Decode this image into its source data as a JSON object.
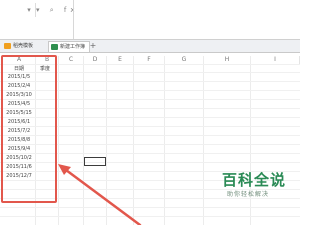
{
  "formula_bar": {
    "name_box": "",
    "icons": [
      "dropdown-icon",
      "zoom-icon",
      "fx-icon"
    ],
    "icon_glyphs": "▾ ⌕ fx"
  },
  "tabs": [
    {
      "label": "稻壳模板",
      "icon": "wps-doc-icon"
    },
    {
      "label": "新建工作簿",
      "icon": "sheet-icon"
    }
  ],
  "new_tab_label": "+",
  "columns": [
    "A",
    "B",
    "C",
    "D",
    "E",
    "F",
    "G",
    "H",
    "I"
  ],
  "table": {
    "headers": [
      "日期",
      "季度"
    ],
    "dates": [
      "2015/1/5",
      "2015/2/4",
      "2015/3/10",
      "2015/4/5",
      "2015/5/15",
      "2015/6/1",
      "2015/7/2",
      "2015/8/8",
      "2015/9/4",
      "2015/10/2",
      "2015/11/6",
      "2015/12/7"
    ]
  },
  "annotation": {
    "highlight_color": "#e2574c"
  },
  "watermark": {
    "title": "百科全说",
    "subtitle": "助你轻松解决"
  }
}
